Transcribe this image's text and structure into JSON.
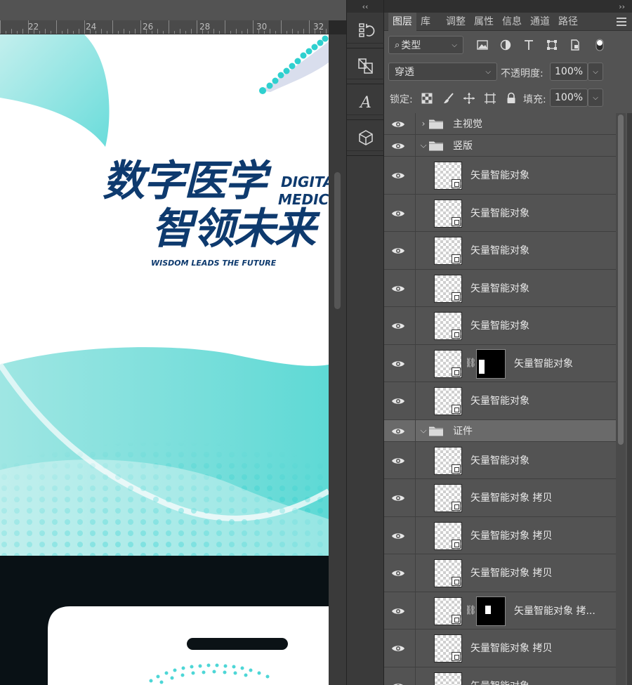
{
  "strip": {
    "collapse_label": "‹‹"
  },
  "panel": {
    "collapse_label": "››"
  },
  "ruler": {
    "labels": [
      "22",
      "24",
      "26",
      "28",
      "30",
      "32"
    ]
  },
  "artwork": {
    "title_cn_1": "数字医学",
    "title_cn_2": "智领未来",
    "title_en_1": "DIGITA",
    "title_en_2": "MEDICIN",
    "tagline": "WISDOM LEADS THE FUTURE",
    "brand_color": "#0e3a6e",
    "teal_color": "#2fd0cf"
  },
  "tabs": [
    "图层",
    "库",
    "调整",
    "属性",
    "信息",
    "通道",
    "路径"
  ],
  "filter": {
    "kind_label": "类型"
  },
  "blend": {
    "mode": "穿透",
    "opacity_label": "不透明度:",
    "opacity_value": "100%"
  },
  "lock": {
    "label": "锁定:",
    "fill_label": "填充:",
    "fill_value": "100%"
  },
  "layers": [
    {
      "type": "group",
      "name": "主视觉",
      "expanded": false
    },
    {
      "type": "group",
      "name": "竖版",
      "expanded": true
    },
    {
      "type": "layer",
      "name": "矢量智能对象"
    },
    {
      "type": "layer",
      "name": "矢量智能对象"
    },
    {
      "type": "layer",
      "name": "矢量智能对象"
    },
    {
      "type": "layer",
      "name": "矢量智能对象"
    },
    {
      "type": "layer",
      "name": "矢量智能对象"
    },
    {
      "type": "layer",
      "name": "矢量智能对象",
      "mask": true
    },
    {
      "type": "layer",
      "name": "矢量智能对象"
    },
    {
      "type": "group",
      "name": "证件",
      "expanded": true,
      "selected": true
    },
    {
      "type": "layer",
      "name": "矢量智能对象"
    },
    {
      "type": "layer",
      "name": "矢量智能对象 拷贝"
    },
    {
      "type": "layer",
      "name": "矢量智能对象 拷贝"
    },
    {
      "type": "layer",
      "name": "矢量智能对象 拷贝"
    },
    {
      "type": "layer",
      "name": "矢量智能对象 拷...",
      "mask": true
    },
    {
      "type": "layer",
      "name": "矢量智能对象 拷贝"
    },
    {
      "type": "layer",
      "name": "矢量智能对象"
    }
  ]
}
